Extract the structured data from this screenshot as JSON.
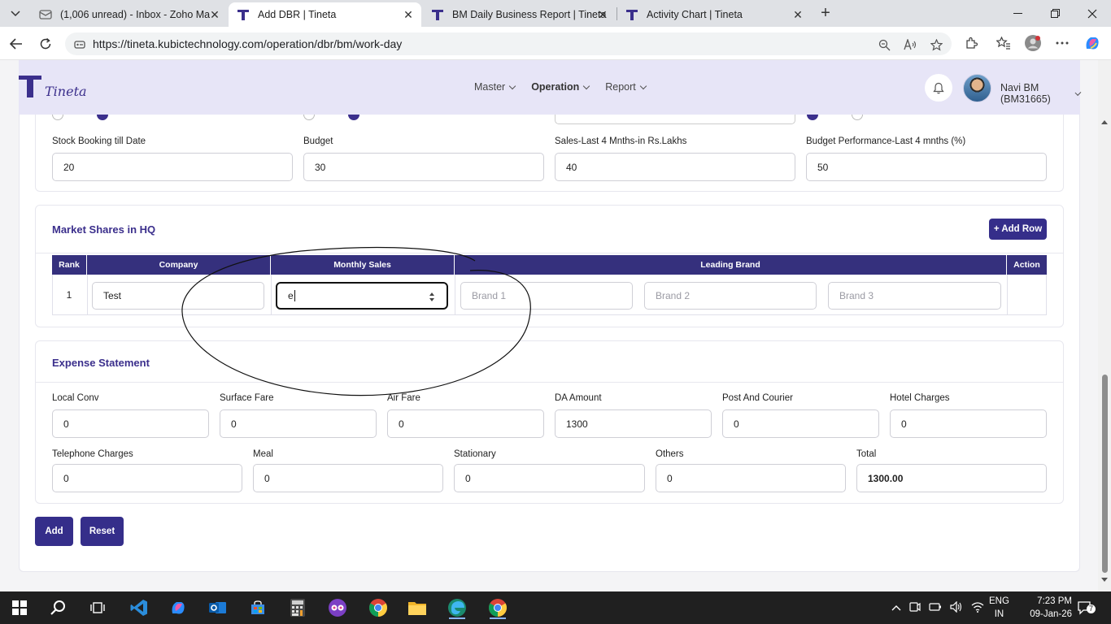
{
  "browser": {
    "tabs": [
      {
        "title": "(1,006 unread) - Inbox - Zoho Ma",
        "icon": "mail-icon",
        "active": false
      },
      {
        "title": "Add DBR | Tineta",
        "icon": "tineta-logo-icon",
        "active": true
      },
      {
        "title": "BM Daily Business Report | Tineta",
        "icon": "tineta-logo-icon",
        "active": false
      },
      {
        "title": "Activity Chart | Tineta",
        "icon": "tineta-logo-icon",
        "active": false
      }
    ],
    "url": "https://tineta.kubictechnology.com/operation/dbr/bm/work-day"
  },
  "app": {
    "brand": "Tineta",
    "nav": [
      {
        "label": "Master"
      },
      {
        "label": "Operation"
      },
      {
        "label": "Report"
      }
    ],
    "user": "Navi BM (BM31665)"
  },
  "stock_section": {
    "fields": [
      {
        "label": "Stock Booking till Date",
        "value": "20"
      },
      {
        "label": "Budget",
        "value": "30"
      },
      {
        "label": "Sales-Last 4 Mnths-in Rs.Lakhs",
        "value": "40"
      },
      {
        "label": "Budget Performance-Last 4 mnths (%)",
        "value": "50"
      }
    ]
  },
  "market_shares": {
    "title": "Market Shares in HQ",
    "add_row_label": "+ Add Row",
    "columns": {
      "rank": "Rank",
      "company": "Company",
      "monthly_sales": "Monthly Sales",
      "leading_brand": "Leading Brand",
      "action": "Action"
    },
    "rows": [
      {
        "rank": "1",
        "company": "Test",
        "monthly_sales": "e",
        "brand1_placeholder": "Brand 1",
        "brand2_placeholder": "Brand 2",
        "brand3_placeholder": "Brand 3"
      }
    ]
  },
  "expense": {
    "title": "Expense Statement",
    "row1": [
      {
        "label": "Local Conv",
        "value": "0"
      },
      {
        "label": "Surface Fare",
        "value": "0"
      },
      {
        "label": "Air Fare",
        "value": "0"
      },
      {
        "label": "DA Amount",
        "value": "1300"
      },
      {
        "label": "Post And Courier",
        "value": "0"
      },
      {
        "label": "Hotel Charges",
        "value": "0"
      }
    ],
    "row2": [
      {
        "label": "Telephone Charges",
        "value": "0"
      },
      {
        "label": "Meal",
        "value": "0"
      },
      {
        "label": "Stationary",
        "value": "0"
      },
      {
        "label": "Others",
        "value": "0"
      },
      {
        "label": "Total",
        "value": "1300.00"
      }
    ]
  },
  "actions": {
    "add": "Add",
    "reset": "Reset"
  },
  "taskbar": {
    "lang1": "ENG",
    "lang2": "IN",
    "time": "7:23 PM",
    "date": "09-Jan-26",
    "notifications": "7"
  },
  "colors": {
    "primary": "#352e8a",
    "header_bg": "#e7e5f7",
    "accent_text": "#3b2f8c"
  }
}
